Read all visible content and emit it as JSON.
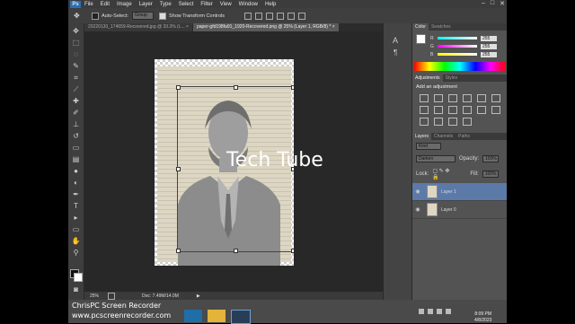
{
  "app": {
    "logo": "Ps"
  },
  "menu": [
    "File",
    "Edit",
    "Image",
    "Layer",
    "Type",
    "Select",
    "Filter",
    "View",
    "Window",
    "Help"
  ],
  "window_controls": [
    "–",
    "□",
    "✕"
  ],
  "options": {
    "auto_select_label": "Auto-Select:",
    "auto_select_value": "Group",
    "show_transform_label": "Show Transform Controls"
  },
  "tabs": [
    "20220130_174659-Recovered.jpg @ 33.3% (L... ×",
    "paper-gfd198fa91_1920-Recovered.png @ 25% (Layer 1, RGB/8) * ×"
  ],
  "status": {
    "zoom": "25%",
    "doc": "Doc: 7.49M/14.0M"
  },
  "color_panel": {
    "tabs": [
      "Color",
      "Swatches"
    ],
    "channels": [
      {
        "name": "R",
        "value": "255"
      },
      {
        "name": "G",
        "value": "255"
      },
      {
        "name": "B",
        "value": "255"
      }
    ]
  },
  "adjustments": {
    "tabs": [
      "Adjustments",
      "Styles"
    ],
    "title": "Add an adjustment"
  },
  "layers": {
    "tabs": [
      "Layers",
      "Channels",
      "Paths"
    ],
    "kind": "Kind",
    "blend_mode": "Darken",
    "opacity_label": "Opacity:",
    "opacity": "100%",
    "lock_label": "Lock:",
    "fill_label": "Fill:",
    "fill": "100%",
    "items": [
      {
        "name": "Layer 1"
      },
      {
        "name": "Layer 0"
      }
    ]
  },
  "overlay": {
    "tech_tube": "Tech Tube",
    "recorder": "ChrisPC Screen Recorder",
    "url": "www.pcscreenrecorder.com"
  },
  "clock": {
    "time": "8:09 PM",
    "date": "4/8/2023"
  },
  "colors": {
    "accent_ps": "#2a6fb0",
    "selected_layer": "#5b7aa8"
  }
}
